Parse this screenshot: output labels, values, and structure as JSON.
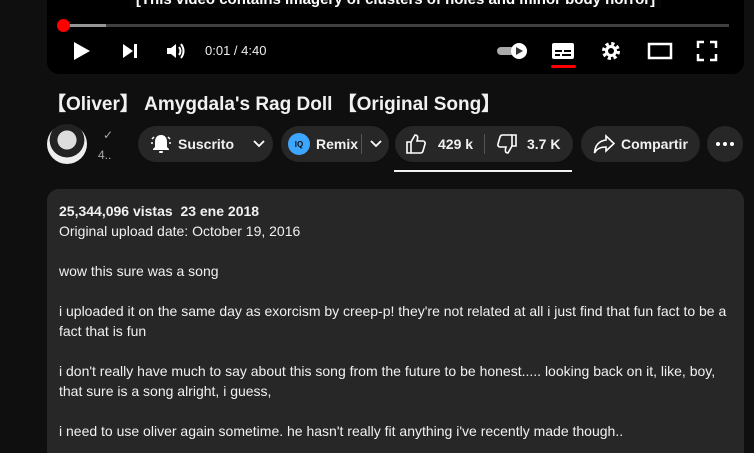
{
  "player": {
    "caption": "[This video contains imagery of clusters of holes and minor body horror]",
    "progress_fraction": 0.0038,
    "time_display": "0:01 / 4:40",
    "accent_color": "#ff0000",
    "icons": [
      "play-icon",
      "next-icon",
      "volume-icon",
      "autoplay-toggle-icon",
      "subtitles-icon",
      "settings-icon",
      "theater-mode-icon",
      "fullscreen-icon"
    ]
  },
  "video": {
    "title": "【Oliver】 Amygdala's Rag Doll 【Original Song】"
  },
  "channel": {
    "verified_glyph": "✓",
    "subscribers": "4.."
  },
  "actions": {
    "subscribe_label": "Suscrito",
    "remix_logo_text": "IQ",
    "remix_label": "Remix",
    "likes": "429 k",
    "dislikes": "3.7 K",
    "share_label": "Compartir"
  },
  "description": {
    "views": "25,344,096 vistas",
    "date": "23 ene 2018",
    "original_upload": "Original upload date: October 19, 2016",
    "paragraphs": [
      "wow this sure was a song",
      "i uploaded it on the same day as exorcism by creep-p! they're not related at all i just find that fun fact to be a fact that is fun",
      "i don't really have much to say about this song from the future to be honest..... looking back on it, like, boy, that sure is a song alright, i guess,",
      "i need to use oliver again sometime. he hasn't really fit anything i've recently made though.."
    ]
  }
}
